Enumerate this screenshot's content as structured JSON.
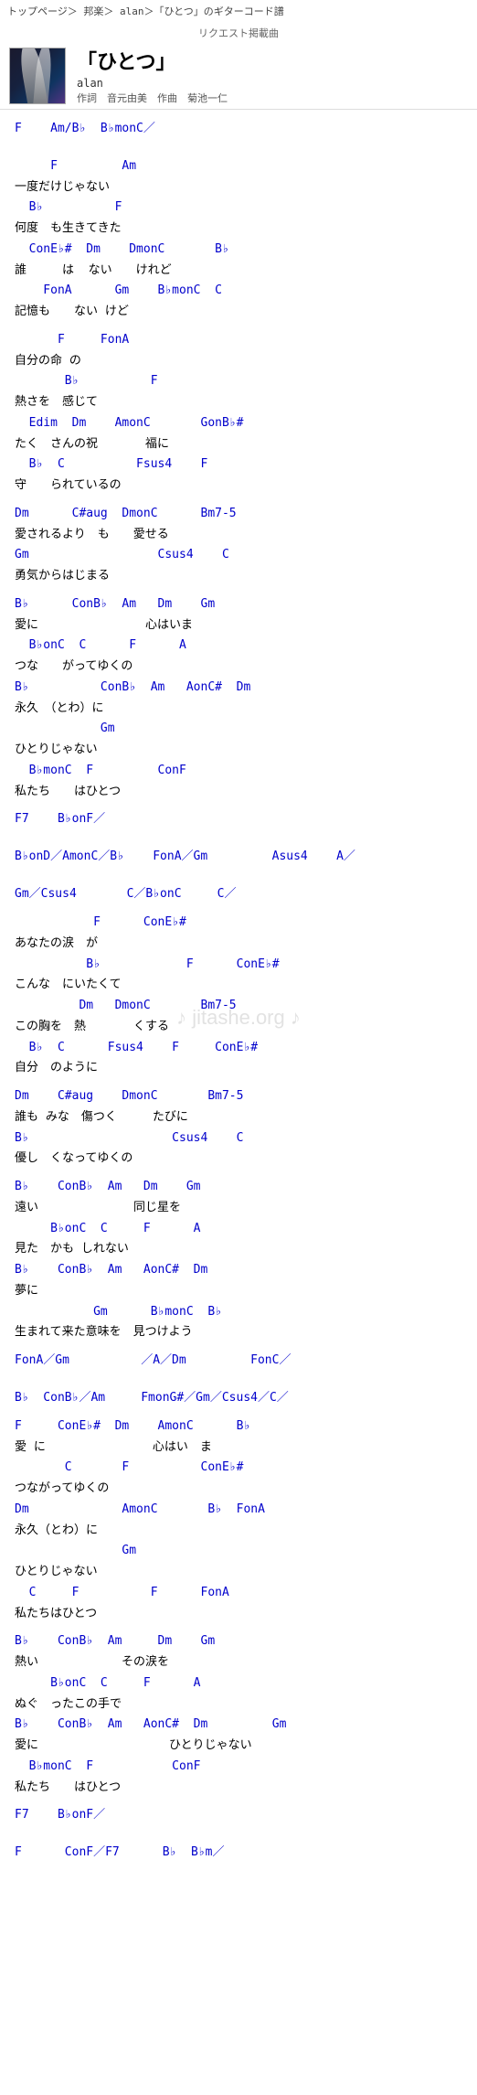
{
  "nav": {
    "breadcrumb": "トップページ＞ 邦楽＞ alan＞「ひとつ」のギターコード譜"
  },
  "header": {
    "request_label": "リクエスト掲載曲",
    "title": "「ひとつ」",
    "artist": "alan",
    "credits": "作詞　音元由美　作曲　菊池一仁"
  },
  "watermark": "♪ jitashe.org ♪",
  "chord_blocks": []
}
